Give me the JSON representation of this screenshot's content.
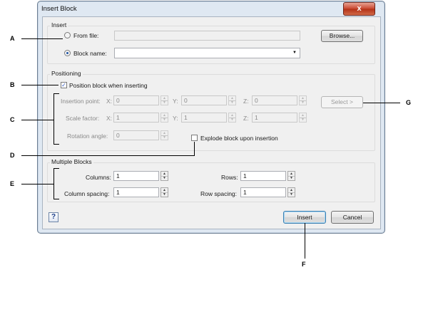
{
  "window": {
    "title": "Insert Block",
    "close_glyph": "x"
  },
  "insert": {
    "group_label": "Insert",
    "from_file_label": "From file:",
    "from_file_value": "",
    "browse_label": "Browse...",
    "block_name_label": "Block name:",
    "block_name_value": ""
  },
  "positioning": {
    "group_label": "Positioning",
    "position_checkbox_label": "Position block when inserting",
    "insertion_point_label": "Insertion point:",
    "scale_factor_label": "Scale factor:",
    "rotation_angle_label": "Rotation angle:",
    "x_label": "X:",
    "y_label": "Y:",
    "z_label": "Z:",
    "insertion_x": "0",
    "insertion_y": "0",
    "insertion_z": "0",
    "scale_x": "1",
    "scale_y": "1",
    "scale_z": "1",
    "rotation": "0",
    "select_label": "Select >",
    "explode_label": "Explode block upon insertion"
  },
  "multiple": {
    "group_label": "Multiple Blocks",
    "columns_label": "Columns:",
    "columns_value": "1",
    "rows_label": "Rows:",
    "rows_value": "1",
    "column_spacing_label": "Column spacing:",
    "column_spacing_value": "1",
    "row_spacing_label": "Row spacing:",
    "row_spacing_value": "1"
  },
  "footer": {
    "help_glyph": "?",
    "insert_label": "Insert",
    "cancel_label": "Cancel"
  },
  "callouts": {
    "a": "A",
    "b": "B",
    "c": "C",
    "d": "D",
    "e": "E",
    "f": "F",
    "g": "G"
  },
  "colors": {
    "title_gradient_top": "#e4edf7",
    "close_red": "#c8452d",
    "accent_blue": "#3c7fb1"
  }
}
